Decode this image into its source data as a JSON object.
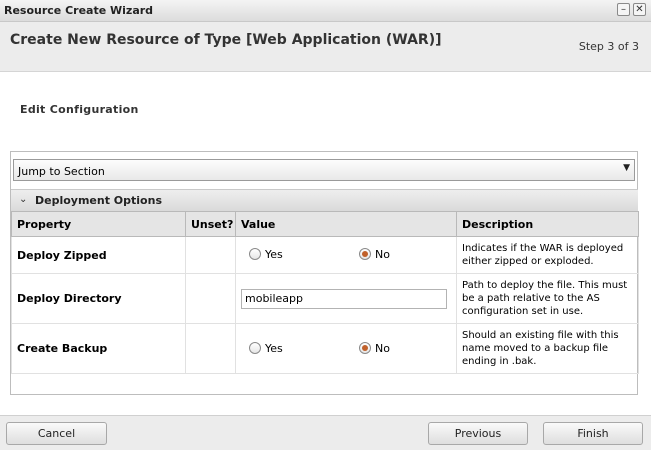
{
  "window": {
    "title": "Resource Create Wizard",
    "minimize_icon": "minimize-icon",
    "close_icon": "close-icon",
    "minimize_glyph": "–",
    "close_glyph": "✕"
  },
  "header": {
    "title": "Create New Resource of Type [Web Application (WAR)]",
    "step": "Step 3 of 3"
  },
  "section_title": "Edit Configuration",
  "jump_to_section": {
    "selected": "Jump to Section",
    "arrow": "▼"
  },
  "group": {
    "chevron": "⌄",
    "label": "Deployment Options"
  },
  "table": {
    "columns": [
      "Property",
      "Unset?",
      "Value",
      "Description"
    ],
    "rows": [
      {
        "property": "Deploy Zipped",
        "options": [
          "Yes",
          "No"
        ],
        "selected": "No",
        "description": "Indicates if the WAR is deployed either zipped or exploded."
      },
      {
        "property": "Deploy Directory",
        "value": "mobileapp",
        "description": "Path to deploy the file. This must be a path relative to the AS configuration set in use."
      },
      {
        "property": "Create Backup",
        "options": [
          "Yes",
          "No"
        ],
        "selected": "No",
        "description": "Should an existing file with this name moved to a backup file ending in .bak."
      }
    ]
  },
  "footer": {
    "cancel": "Cancel",
    "previous": "Previous",
    "finish": "Finish"
  },
  "colors": {
    "radio_selected": "#c0602a"
  }
}
